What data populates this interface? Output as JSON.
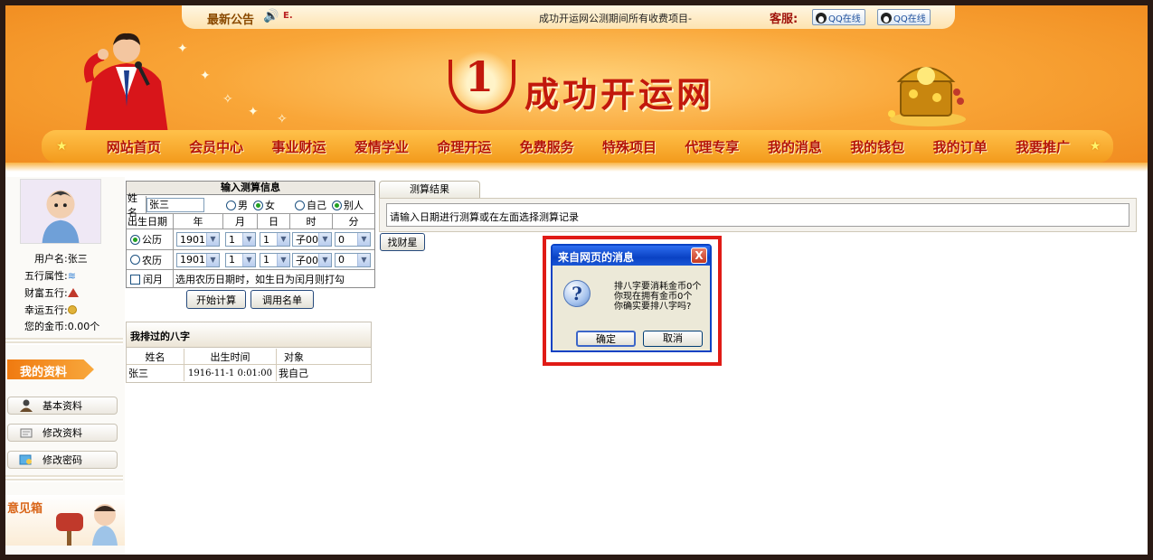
{
  "notice": {
    "title": "最新公告",
    "small": "E.",
    "text": "成功开运网公测期间所有收费项目-",
    "service_label": "客服:",
    "qq_buttons": [
      "QQ在线",
      "QQ在线"
    ]
  },
  "site": {
    "logo_number": "1",
    "logo_text": "成功开运网"
  },
  "nav": {
    "items": [
      "网站首页",
      "会员中心",
      "事业财运",
      "爱情学业",
      "命理开运",
      "免费服务",
      "特殊项目",
      "代理专享",
      "我的消息",
      "我的钱包",
      "我的订单",
      "我要推广"
    ]
  },
  "sidebar": {
    "username": "用户名:张三",
    "wuxing": "五行属性:",
    "caifu": "财富五行:",
    "xingyun": "幸运五行:",
    "gold": "您的金币:0.00个",
    "profile_title": "我的资料",
    "buttons": [
      "基本资料",
      "修改资料",
      "修改密码"
    ],
    "suggest_title": "意见箱"
  },
  "input_form": {
    "title": "输入测算信息",
    "name_label": "姓名",
    "name_value": "张三",
    "gender_male": "男",
    "gender_female": "女",
    "self_label": "自己",
    "other_label": "别人",
    "birth_label": "出生日期",
    "col_year": "年",
    "col_month": "月",
    "col_day": "日",
    "col_hour": "时",
    "col_minute": "分",
    "solar_label": "公历",
    "lunar_label": "农历",
    "solar_values": [
      "1901",
      "1",
      "1",
      "子00",
      "0"
    ],
    "lunar_values": [
      "1901",
      "1",
      "1",
      "子00",
      "0"
    ],
    "leap_label": "闰月",
    "leap_note": "选用农历日期时，如生日为闰月则打勾",
    "calc_button": "开始计算",
    "names_button": "调用名单"
  },
  "history": {
    "title": "我排过的八字",
    "columns": [
      "姓名",
      "出生时间",
      "对象"
    ],
    "rows": [
      {
        "name": "张三",
        "birth": "1916-11-1 0:01:00",
        "target": "我自己"
      }
    ]
  },
  "result": {
    "tab": "测算结果",
    "placeholder": "请输入日期进行测算或在左面选择测算记录",
    "find_button": "找财星"
  },
  "dialog": {
    "title": "来自网页的消息",
    "close": "X",
    "icon": "?",
    "lines": [
      "排八字要消耗金币0个",
      "你现在拥有金币0个",
      "你确实要排八字吗?"
    ],
    "ok": "确定",
    "cancel": "取消"
  },
  "colors": {
    "accent": "#f39a1c",
    "brand_red": "#c2180c",
    "dialog_blue": "#0a42c4",
    "highlight": "#e01b16"
  }
}
